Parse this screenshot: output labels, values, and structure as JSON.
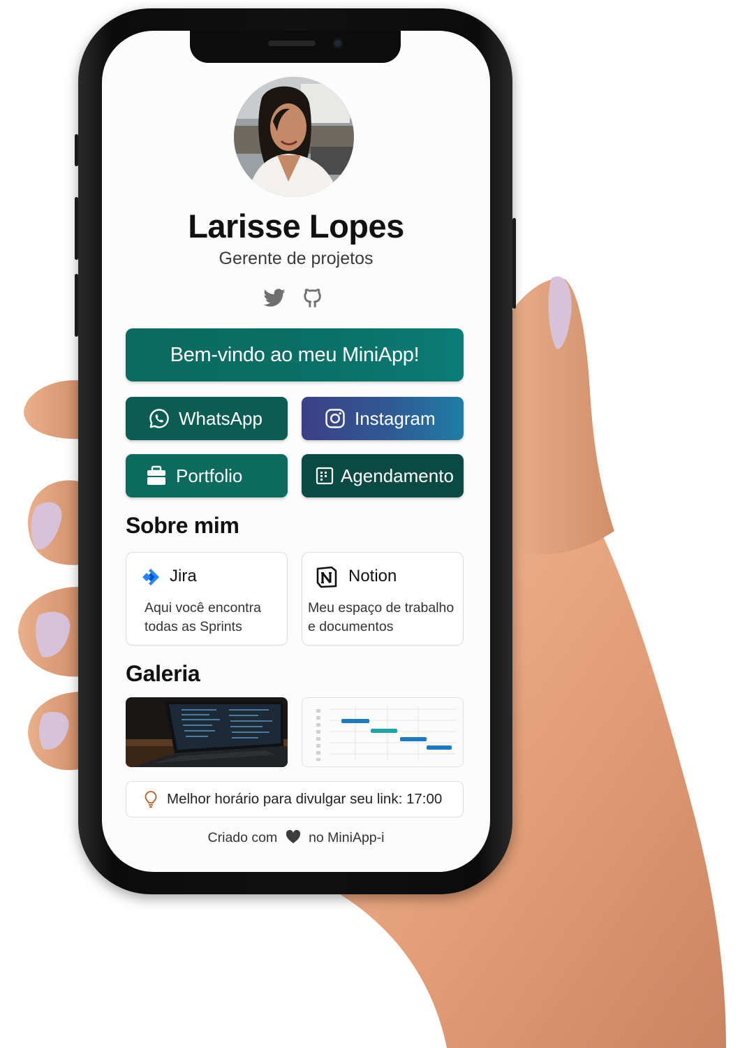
{
  "profile": {
    "name": "Larisse Lopes",
    "role": "Gerente de projetos",
    "avatar_icon": "profile-photo"
  },
  "socials": [
    {
      "icon": "twitter-icon"
    },
    {
      "icon": "github-icon"
    }
  ],
  "welcome_label": "Bem-vindo ao meu MiniApp!",
  "buttons": {
    "whatsapp": "WhatsApp",
    "instagram": "Instagram",
    "portfolio": "Portfolio",
    "agendamento": "Agendamento"
  },
  "about": {
    "heading": "Sobre mim",
    "cards": [
      {
        "title": "Jira",
        "description": "Aqui você encontra todas as Sprints",
        "icon": "jira-icon"
      },
      {
        "title": "Notion",
        "description": "Meu espaço de trabalho e documentos",
        "icon": "notion-icon"
      }
    ]
  },
  "gallery": {
    "heading": "Galeria",
    "items": [
      {
        "icon": "laptop-photo"
      },
      {
        "icon": "gantt-chart-image"
      }
    ]
  },
  "tip": {
    "text": "Melhor horário para divulgar seu link: 17:00",
    "icon": "lightbulb-icon"
  },
  "footer": {
    "prefix": "Criado com",
    "suffix": "no MiniApp-i",
    "icon": "heart-icon"
  },
  "colors": {
    "welcome": "#0c6a60",
    "whatsapp": "#0b5c52",
    "instagram_start": "#3c3f85",
    "instagram_end": "#1f7ea3",
    "portfolio": "#0c6a5e",
    "agendamento": "#0a4a42"
  }
}
